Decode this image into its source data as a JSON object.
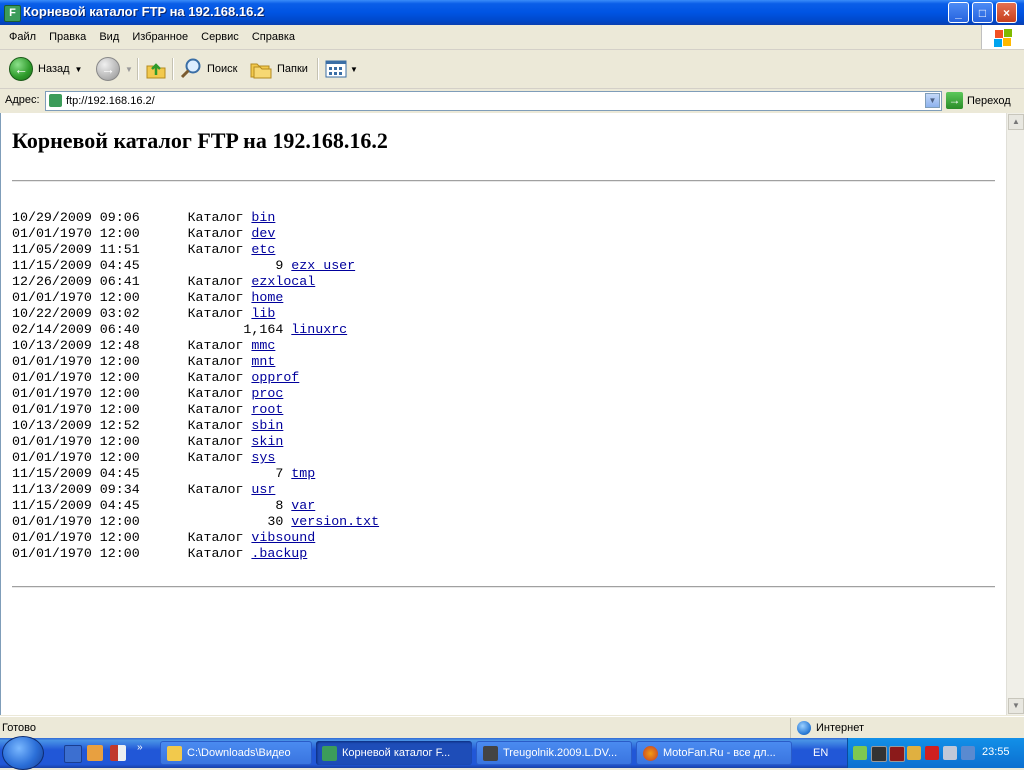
{
  "window": {
    "title": "Корневой каталог FTP на 192.168.16.2",
    "minimize": "_",
    "maximize": "□",
    "close": "×"
  },
  "menu": [
    "Файл",
    "Правка",
    "Вид",
    "Избранное",
    "Сервис",
    "Справка"
  ],
  "toolbar": {
    "back_label": "Назад",
    "search_label": "Поиск",
    "folders_label": "Папки"
  },
  "address": {
    "label": "Адрес:",
    "value": "ftp://192.168.16.2/",
    "go_label": "Переход"
  },
  "page": {
    "heading": "Корневой каталог FTP на 192.168.16.2",
    "dir_label": "Каталог",
    "entries": [
      {
        "date": "10/29/2009 09:06",
        "size": null,
        "name": "bin"
      },
      {
        "date": "01/01/1970 12:00",
        "size": null,
        "name": "dev"
      },
      {
        "date": "11/05/2009 11:51",
        "size": null,
        "name": "etc"
      },
      {
        "date": "11/15/2009 04:45",
        "size": "9",
        "name": "ezx_user"
      },
      {
        "date": "12/26/2009 06:41",
        "size": null,
        "name": "ezxlocal"
      },
      {
        "date": "01/01/1970 12:00",
        "size": null,
        "name": "home"
      },
      {
        "date": "10/22/2009 03:02",
        "size": null,
        "name": "lib"
      },
      {
        "date": "02/14/2009 06:40",
        "size": "1,164",
        "name": "linuxrc"
      },
      {
        "date": "10/13/2009 12:48",
        "size": null,
        "name": "mmc"
      },
      {
        "date": "01/01/1970 12:00",
        "size": null,
        "name": "mnt"
      },
      {
        "date": "01/01/1970 12:00",
        "size": null,
        "name": "opprof"
      },
      {
        "date": "01/01/1970 12:00",
        "size": null,
        "name": "proc"
      },
      {
        "date": "01/01/1970 12:00",
        "size": null,
        "name": "root"
      },
      {
        "date": "10/13/2009 12:52",
        "size": null,
        "name": "sbin"
      },
      {
        "date": "01/01/1970 12:00",
        "size": null,
        "name": "skin"
      },
      {
        "date": "01/01/1970 12:00",
        "size": null,
        "name": "sys"
      },
      {
        "date": "11/15/2009 04:45",
        "size": "7",
        "name": "tmp"
      },
      {
        "date": "11/13/2009 09:34",
        "size": null,
        "name": "usr"
      },
      {
        "date": "11/15/2009 04:45",
        "size": "8",
        "name": "var"
      },
      {
        "date": "01/01/1970 12:00",
        "size": "30",
        "name": "version.txt"
      },
      {
        "date": "01/01/1970 12:00",
        "size": null,
        "name": "vibsound"
      },
      {
        "date": "01/01/1970 12:00",
        "size": null,
        "name": ".backup"
      }
    ]
  },
  "status": {
    "text": "Готово",
    "zone": "Интернет"
  },
  "taskbar": {
    "tasks": [
      {
        "label": "C:\\Downloads\\Видео"
      },
      {
        "label": "Корневой каталог F..."
      },
      {
        "label": "Treugolnik.2009.L.DV..."
      },
      {
        "label": "MotoFan.Ru - все дл..."
      }
    ],
    "lang": "EN",
    "clock": "23:55"
  },
  "colors": {
    "link": "#00009C",
    "titlebar": "#0054E3",
    "taskbar": "#2157D7"
  }
}
